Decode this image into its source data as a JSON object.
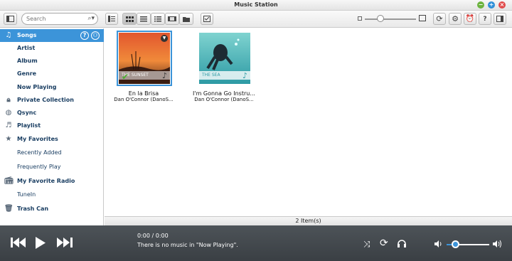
{
  "window": {
    "title": "Music Station"
  },
  "toolbar": {
    "search_placeholder": "Search"
  },
  "sidebar": {
    "items": [
      {
        "label": "Songs",
        "icon": "music-note-icon"
      },
      {
        "label": "Artist"
      },
      {
        "label": "Album"
      },
      {
        "label": "Genre"
      },
      {
        "label": "Now Playing"
      },
      {
        "label": "Private Collection",
        "icon": "lock-icon"
      },
      {
        "label": "Qsync",
        "icon": "qsync-icon"
      },
      {
        "label": "Playlist",
        "icon": "playlist-icon"
      },
      {
        "label": "My Favorites",
        "icon": "star-icon"
      },
      {
        "label": "Recently Added"
      },
      {
        "label": "Frequently Play"
      },
      {
        "label": "My Favorite Radio",
        "icon": "radio-icon"
      },
      {
        "label": "TuneIn"
      },
      {
        "label": "Trash Can",
        "icon": "trash-icon"
      }
    ]
  },
  "songs": [
    {
      "title": "En la Brisa",
      "artist": "Dan O'Connor (DanoS...",
      "cover_label": "THE SUNSET"
    },
    {
      "title": "I'm Gonna Go Instru...",
      "artist": "Dan O'Connor (DanoS...",
      "cover_label": "THE SEA"
    }
  ],
  "status": {
    "item_count": "2 Item(s)"
  },
  "player": {
    "time": "0:00 / 0:00",
    "message": "There is no music in \"Now Playing\".",
    "volume": 0.2
  },
  "colors": {
    "accent": "#3c94d9",
    "player_bg": "#44494e"
  }
}
